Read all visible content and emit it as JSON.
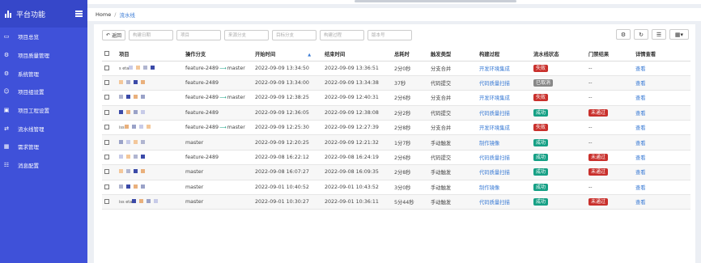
{
  "sidebar": {
    "title": "平台功能",
    "items": [
      {
        "icon": "monitor-icon",
        "label": "项目总览"
      },
      {
        "icon": "cogs-icon",
        "label": "项目质量管理"
      },
      {
        "icon": "gear-icon",
        "label": "系统管理"
      },
      {
        "icon": "users-icon",
        "label": "项目组设置"
      },
      {
        "icon": "cubes-icon",
        "label": "项目工程设置"
      },
      {
        "icon": "shuffle-icon",
        "label": "流水线管理"
      },
      {
        "icon": "calendar-icon",
        "label": "需求管理"
      },
      {
        "icon": "sitemap-icon",
        "label": "消息配置"
      }
    ]
  },
  "breadcrumb": {
    "home": "Home",
    "separator": "/",
    "current": "流水线"
  },
  "toolbar": {
    "back_label": "返回",
    "filters": [
      "构建日期",
      "项目",
      "来源分支",
      "目标分支",
      "构建过程",
      "版本号"
    ]
  },
  "table": {
    "headers": [
      "",
      "项目",
      "操作分支",
      "开始时间",
      "结束时间",
      "总耗时",
      "触发类型",
      "构建过程",
      "流水线状态",
      "门禁结果",
      "详情查看"
    ],
    "rows": [
      {
        "project": "s        eta",
        "branch_from": "feature-2489",
        "branch_to": "master",
        "start": "2022-09-09 13:34:50",
        "end": "2022-09-09 13:36:51",
        "duration": "2分0秒",
        "trigger": "分支合并",
        "process": "开发环境集成",
        "status": "失败",
        "status_type": "fail",
        "gate": "--",
        "gate_type": "",
        "detail": "查看"
      },
      {
        "project": "",
        "branch_from": "feature-2489",
        "branch_to": "",
        "start": "2022-09-09 13:34:00",
        "end": "2022-09-09 13:34:38",
        "duration": "37秒",
        "trigger": "代码提交",
        "process": "代码质量扫描",
        "status": "已取消",
        "status_type": "cancel",
        "gate": "--",
        "gate_type": "",
        "detail": "查看"
      },
      {
        "project": "",
        "branch_from": "feature-2489",
        "branch_to": "master",
        "start": "2022-09-09 12:38:25",
        "end": "2022-09-09 12:40:31",
        "duration": "2分6秒",
        "trigger": "分支合并",
        "process": "开发环境集成",
        "status": "失败",
        "status_type": "fail",
        "gate": "--",
        "gate_type": "",
        "detail": "查看"
      },
      {
        "project": "",
        "branch_from": "feature-2489",
        "branch_to": "",
        "start": "2022-09-09 12:36:05",
        "end": "2022-09-09 12:38:08",
        "duration": "2分2秒",
        "trigger": "代码提交",
        "process": "代码质量扫描",
        "status": "成功",
        "status_type": "ok",
        "gate": "未通过",
        "gate_type": "notpass",
        "detail": "查看"
      },
      {
        "project": "iss",
        "branch_from": "feature-2489",
        "branch_to": "master",
        "start": "2022-09-09 12:25:30",
        "end": "2022-09-09 12:27:39",
        "duration": "2分8秒",
        "trigger": "分支合并",
        "process": "开发环境集成",
        "status": "失败",
        "status_type": "fail",
        "gate": "--",
        "gate_type": "",
        "detail": "查看"
      },
      {
        "project": "",
        "branch_from": "master",
        "branch_to": "",
        "start": "2022-09-09 12:20:25",
        "end": "2022-09-09 12:21:32",
        "duration": "1分7秒",
        "trigger": "手动触发",
        "process": "制作镜像",
        "status": "成功",
        "status_type": "ok",
        "gate": "--",
        "gate_type": "",
        "detail": "查看"
      },
      {
        "project": "",
        "branch_from": "feature-2489",
        "branch_to": "",
        "start": "2022-09-08 16:22:12",
        "end": "2022-09-08 16:24:19",
        "duration": "2分6秒",
        "trigger": "代码提交",
        "process": "代码质量扫描",
        "status": "成功",
        "status_type": "ok",
        "gate": "未通过",
        "gate_type": "notpass",
        "detail": "查看"
      },
      {
        "project": "",
        "branch_from": "master",
        "branch_to": "",
        "start": "2022-09-08 16:07:27",
        "end": "2022-09-08 16:09:35",
        "duration": "2分8秒",
        "trigger": "手动触发",
        "process": "代码质量扫描",
        "status": "成功",
        "status_type": "ok",
        "gate": "未通过",
        "gate_type": "notpass",
        "detail": "查看"
      },
      {
        "project": "",
        "branch_from": "master",
        "branch_to": "",
        "start": "2022-09-01 10:40:52",
        "end": "2022-09-01 10:43:52",
        "duration": "3分0秒",
        "trigger": "手动触发",
        "process": "制作镜像",
        "status": "成功",
        "status_type": "ok",
        "gate": "--",
        "gate_type": "",
        "detail": "查看"
      },
      {
        "project": "iss        eta",
        "branch_from": "master",
        "branch_to": "",
        "start": "2022-09-01 10:30:27",
        "end": "2022-09-01 10:36:11",
        "duration": "5分44秒",
        "trigger": "手动触发",
        "process": "代码质量扫描",
        "status": "成功",
        "status_type": "ok",
        "gate": "未通过",
        "gate_type": "notpass",
        "detail": "查看"
      }
    ]
  },
  "colors": {
    "sidebar": "#3f51d9",
    "link": "#3a7bd5",
    "success": "#16a085",
    "fail": "#c9302c",
    "cancel": "#888888"
  }
}
